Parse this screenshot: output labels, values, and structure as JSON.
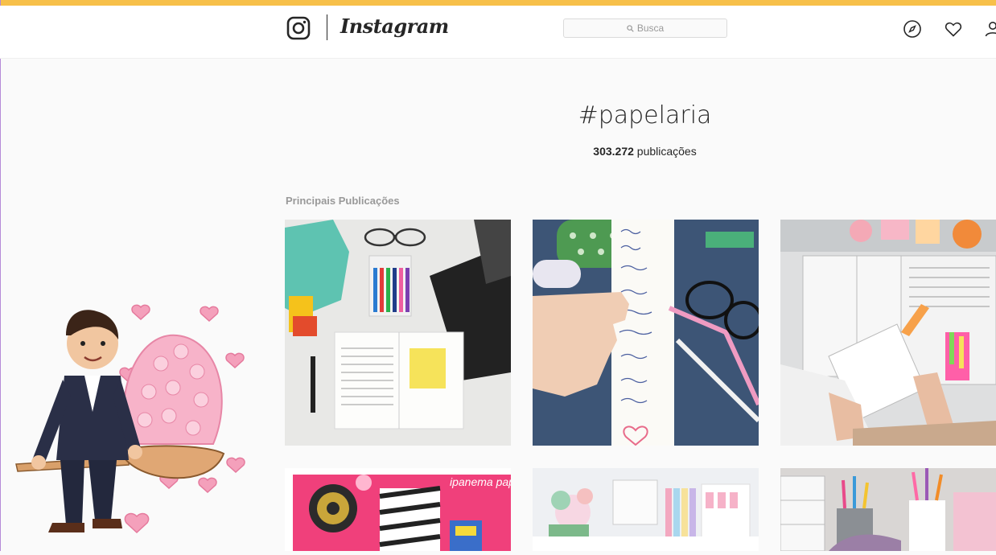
{
  "header": {
    "wordmark": "Instagram",
    "search_placeholder": "Busca",
    "nav_icons": [
      "compass-icon",
      "heart-icon",
      "user-icon"
    ]
  },
  "hashtag": {
    "title": "#papelaria",
    "count_number": "303.272",
    "count_label": "publicações"
  },
  "section": {
    "top_posts_label": "Principais Publicações"
  },
  "posts": [
    {
      "photo": "stationery-flatlay-open-book-keyboard"
    },
    {
      "photo": "hand-holding-handwritten-paper-strip"
    },
    {
      "photo": "study-desk-open-books-highlighters"
    },
    {
      "photo": "pink-planner-stationery",
      "label": "ipanema paper"
    },
    {
      "photo": "pastel-stationery-shelf"
    },
    {
      "photo": "pencil-cups-and-drawers"
    }
  ],
  "colors": {
    "top_accent": "#f7c04a",
    "background": "#fafafa",
    "muted_text": "#999999"
  }
}
